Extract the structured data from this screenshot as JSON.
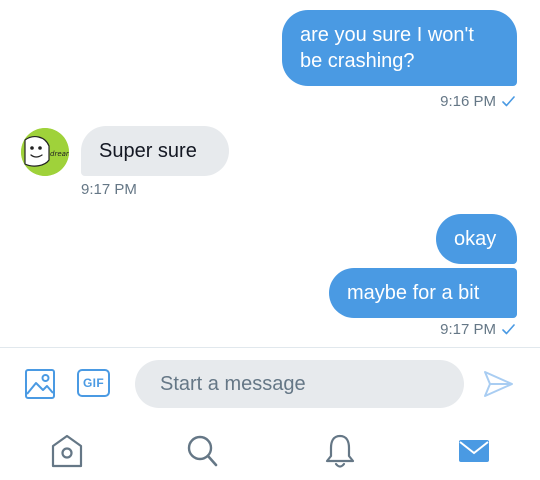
{
  "colors": {
    "accent": "#4A9AE3",
    "incoming_bubble": "#E7EAED",
    "meta_text": "#657786",
    "avatar_bg": "#9FD23A"
  },
  "messages": [
    {
      "direction": "outgoing",
      "text": "are you sure I won't be crashing?",
      "time": "9:16 PM",
      "read_receipt": "check-icon"
    },
    {
      "direction": "incoming",
      "sender_avatar_text": "dream",
      "text": "Super sure",
      "time": "9:17 PM"
    },
    {
      "direction": "outgoing",
      "text": "okay"
    },
    {
      "direction": "outgoing",
      "text": "maybe for a bit",
      "time": "9:17 PM",
      "read_receipt": "check-icon"
    }
  ],
  "composer": {
    "image_icon": "image-icon",
    "gif_label": "GIF",
    "placeholder": "Start a message",
    "value": "",
    "send_icon": "send-icon"
  },
  "tabbar": [
    {
      "icon": "home-icon",
      "active": false
    },
    {
      "icon": "search-icon",
      "active": false
    },
    {
      "icon": "notifications-icon",
      "active": false
    },
    {
      "icon": "messages-icon",
      "active": true
    }
  ]
}
